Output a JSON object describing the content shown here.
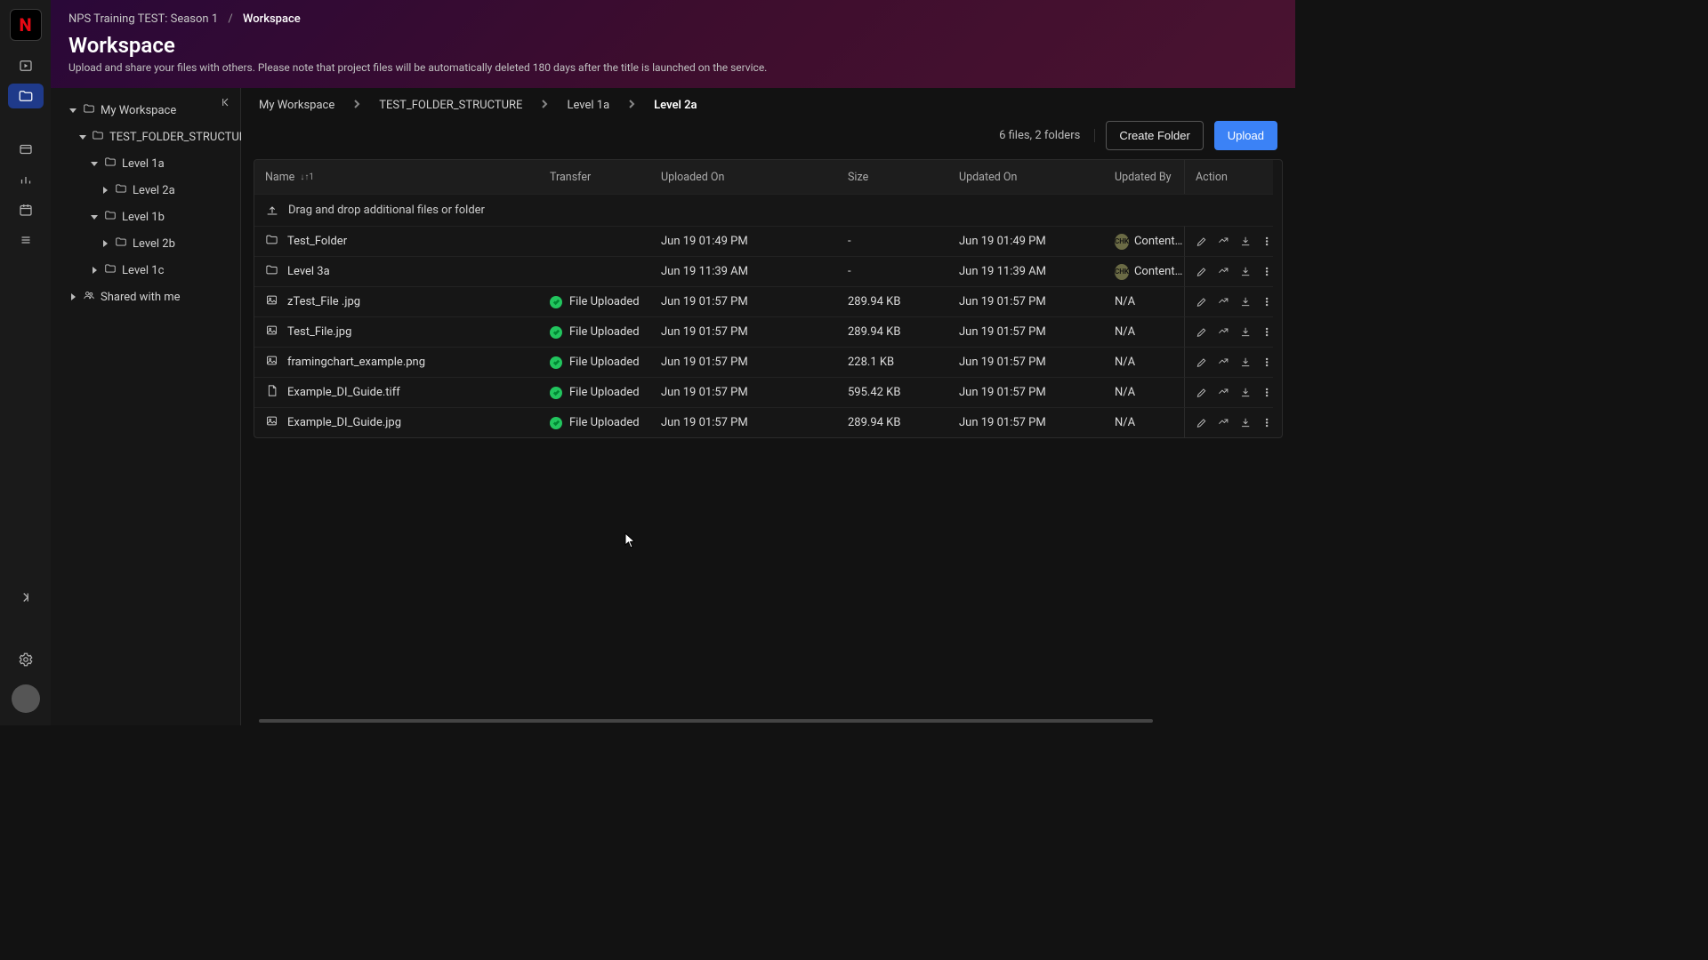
{
  "rail": {
    "logo_letter": "N"
  },
  "header": {
    "crumb_project": "NPS Training TEST: Season 1",
    "crumb_current": "Workspace",
    "title": "Workspace",
    "subtitle": "Upload and share your files with others. Please note that project files will be automatically deleted 180 days after the title is launched on the service."
  },
  "tree": {
    "root": "My Workspace",
    "folder1": "TEST_FOLDER_STRUCTURE",
    "l1a": "Level 1a",
    "l2a": "Level 2a",
    "l1b": "Level 1b",
    "l2b": "Level 2b",
    "l1c": "Level 1c",
    "shared": "Shared with me"
  },
  "breadcrumb": {
    "c1": "My Workspace",
    "c2": "TEST_FOLDER_STRUCTURE",
    "c3": "Level 1a",
    "c4": "Level 2a"
  },
  "toolbar": {
    "counts": "6 files, 2 folders",
    "create_folder": "Create Folder",
    "upload": "Upload"
  },
  "columns": {
    "name": "Name",
    "transfer": "Transfer",
    "uploaded_on": "Uploaded On",
    "size": "Size",
    "updated_on": "Updated On",
    "updated_by": "Updated By",
    "action": "Action"
  },
  "sort_indicator": "↓↑1",
  "drop_hint": "Drag and drop additional files or folder",
  "transfer_status": "File Uploaded",
  "avatar_initials": "CHK",
  "rows": [
    {
      "type": "folder",
      "name": "Test_Folder",
      "transfer": "",
      "uploaded": "Jun 19 01:49 PM",
      "size": "-",
      "updated": "Jun 19 01:49 PM",
      "by": "Content Hub Kar"
    },
    {
      "type": "folder",
      "name": "Level 3a",
      "transfer": "",
      "uploaded": "Jun 19 11:39 AM",
      "size": "-",
      "updated": "Jun 19 11:39 AM",
      "by": "Content Hub Kar"
    },
    {
      "type": "image",
      "name": "zTest_File .jpg",
      "transfer": "ok",
      "uploaded": "Jun 19 01:57 PM",
      "size": "289.94 KB",
      "updated": "Jun 19 01:57 PM",
      "by": "N/A"
    },
    {
      "type": "image",
      "name": "Test_File.jpg",
      "transfer": "ok",
      "uploaded": "Jun 19 01:57 PM",
      "size": "289.94 KB",
      "updated": "Jun 19 01:57 PM",
      "by": "N/A"
    },
    {
      "type": "image",
      "name": "framingchart_example.png",
      "transfer": "ok",
      "uploaded": "Jun 19 01:57 PM",
      "size": "228.1 KB",
      "updated": "Jun 19 01:57 PM",
      "by": "N/A"
    },
    {
      "type": "file",
      "name": "Example_DI_Guide.tiff",
      "transfer": "ok",
      "uploaded": "Jun 19 01:57 PM",
      "size": "595.42 KB",
      "updated": "Jun 19 01:57 PM",
      "by": "N/A"
    },
    {
      "type": "image",
      "name": "Example_DI_Guide.jpg",
      "transfer": "ok",
      "uploaded": "Jun 19 01:57 PM",
      "size": "289.94 KB",
      "updated": "Jun 19 01:57 PM",
      "by": "N/A"
    }
  ]
}
